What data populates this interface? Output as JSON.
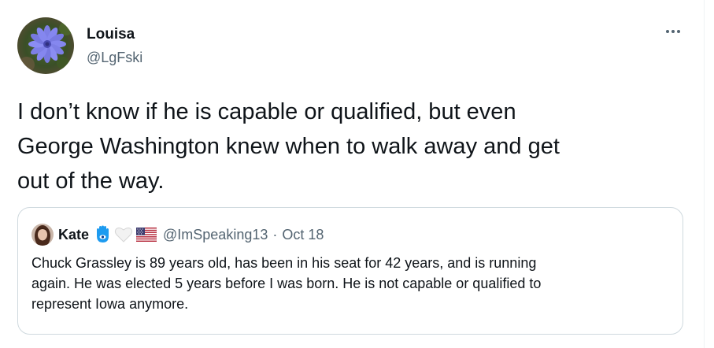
{
  "tweet": {
    "author_name": "Louisa",
    "author_handle": "@LgFski",
    "text": "I don’t know if he is capable or qualified, but even\nGeorge Washington knew when to walk away and get\nout of the way.",
    "more_icon": "ellipsis-icon"
  },
  "quote": {
    "author_name": "Kate",
    "emojis": [
      "hamsa-icon",
      "white-heart-icon",
      "us-flag-icon"
    ],
    "author_handle": "@ImSpeaking13",
    "separator": "·",
    "timestamp": "Oct 18",
    "text": "Chuck Grassley is 89 years old, has been in his seat for 42 years, and is running\nagain. He was elected 5 years before I was born. He is not capable or qualified to\nrepresent Iowa anymore."
  },
  "colors": {
    "text_primary": "#0f1419",
    "text_secondary": "#536471",
    "border": "#cfd9de"
  }
}
